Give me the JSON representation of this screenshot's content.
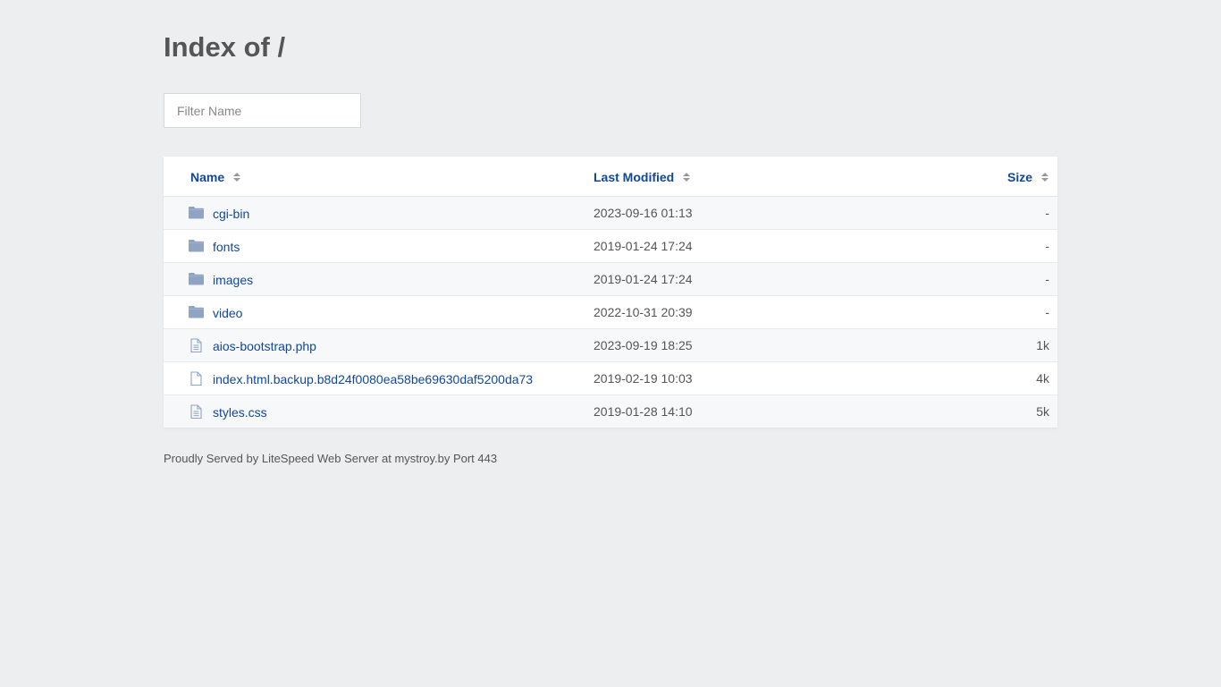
{
  "title": "Index of /",
  "filter": {
    "placeholder": "Filter Name",
    "value": ""
  },
  "columns": {
    "name": "Name",
    "modified": "Last Modified",
    "size": "Size"
  },
  "rows": [
    {
      "type": "folder",
      "icon": "folder-icon",
      "name": "cgi-bin",
      "modified": "2023-09-16 01:13",
      "size": "-"
    },
    {
      "type": "folder",
      "icon": "folder-icon",
      "name": "fonts",
      "modified": "2019-01-24 17:24",
      "size": "-"
    },
    {
      "type": "folder",
      "icon": "folder-icon",
      "name": "images",
      "modified": "2019-01-24 17:24",
      "size": "-"
    },
    {
      "type": "folder",
      "icon": "folder-icon",
      "name": "video",
      "modified": "2022-10-31 20:39",
      "size": "-"
    },
    {
      "type": "text-file",
      "icon": "text-file-icon",
      "name": "aios-bootstrap.php",
      "modified": "2023-09-19 18:25",
      "size": "1k"
    },
    {
      "type": "file",
      "icon": "file-icon",
      "name": "index.html.backup.b8d24f0080ea58be69630daf5200da73",
      "modified": "2019-02-19 10:03",
      "size": "4k"
    },
    {
      "type": "text-file",
      "icon": "text-file-icon",
      "name": "styles.css",
      "modified": "2019-01-28 14:10",
      "size": "5k"
    }
  ],
  "footer": "Proudly Served by LiteSpeed Web Server at mystroy.by Port 443",
  "colors": {
    "link": "#10479b",
    "folder": "#8fa3c2",
    "background": "#eceef0"
  }
}
